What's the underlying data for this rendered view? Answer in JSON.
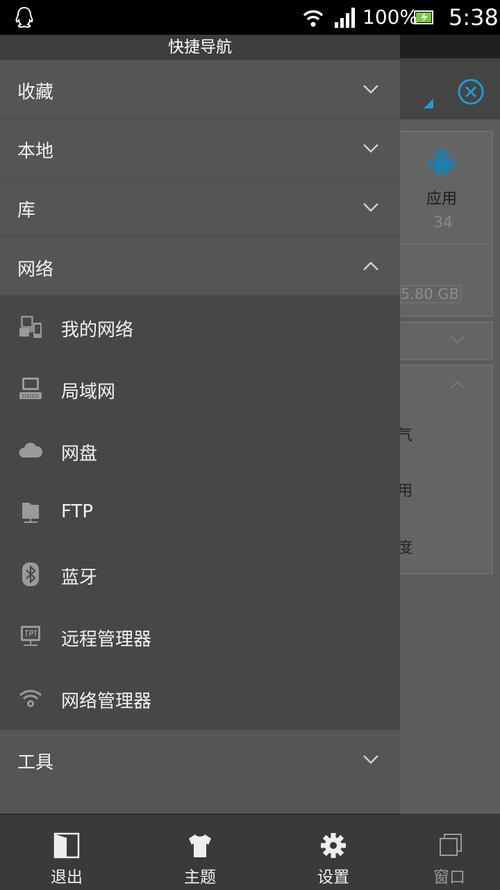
{
  "status_bar": {
    "battery_percent": "100%",
    "time": "5:38",
    "icons": [
      "qq-icon",
      "wifi-icon",
      "signal-icon",
      "battery-charging-icon"
    ]
  },
  "drawer": {
    "title": "快捷导航",
    "sections": [
      {
        "label": "收藏",
        "expanded": false
      },
      {
        "label": "本地",
        "expanded": false
      },
      {
        "label": "库",
        "expanded": false
      },
      {
        "label": "网络",
        "expanded": true
      }
    ],
    "network_items": [
      {
        "label": "我的网络",
        "icon": "my-network-icon"
      },
      {
        "label": "局域网",
        "icon": "lan-icon"
      },
      {
        "label": "网盘",
        "icon": "cloud-icon"
      },
      {
        "label": "FTP",
        "icon": "ftp-icon"
      },
      {
        "label": "蓝牙",
        "icon": "bluetooth-icon"
      },
      {
        "label": "远程管理器",
        "icon": "remote-manager-icon"
      },
      {
        "label": "网络管理器",
        "icon": "network-manager-icon"
      }
    ],
    "tools_section": {
      "label": "工具",
      "expanded": false
    },
    "bottom_bar": [
      {
        "label": "退出",
        "icon": "exit-icon"
      },
      {
        "label": "主题",
        "icon": "theme-icon"
      },
      {
        "label": "设置",
        "icon": "settings-icon"
      }
    ]
  },
  "background": {
    "app_label": "应用",
    "app_count": "34",
    "storage_size": "5.80 GB",
    "partial_texts": [
      "气",
      "用",
      "度"
    ],
    "window_label": "窗口"
  },
  "colors": {
    "accent": "#1e9ad6",
    "drawer_bg": "#444444",
    "section_bg": "#555555"
  }
}
